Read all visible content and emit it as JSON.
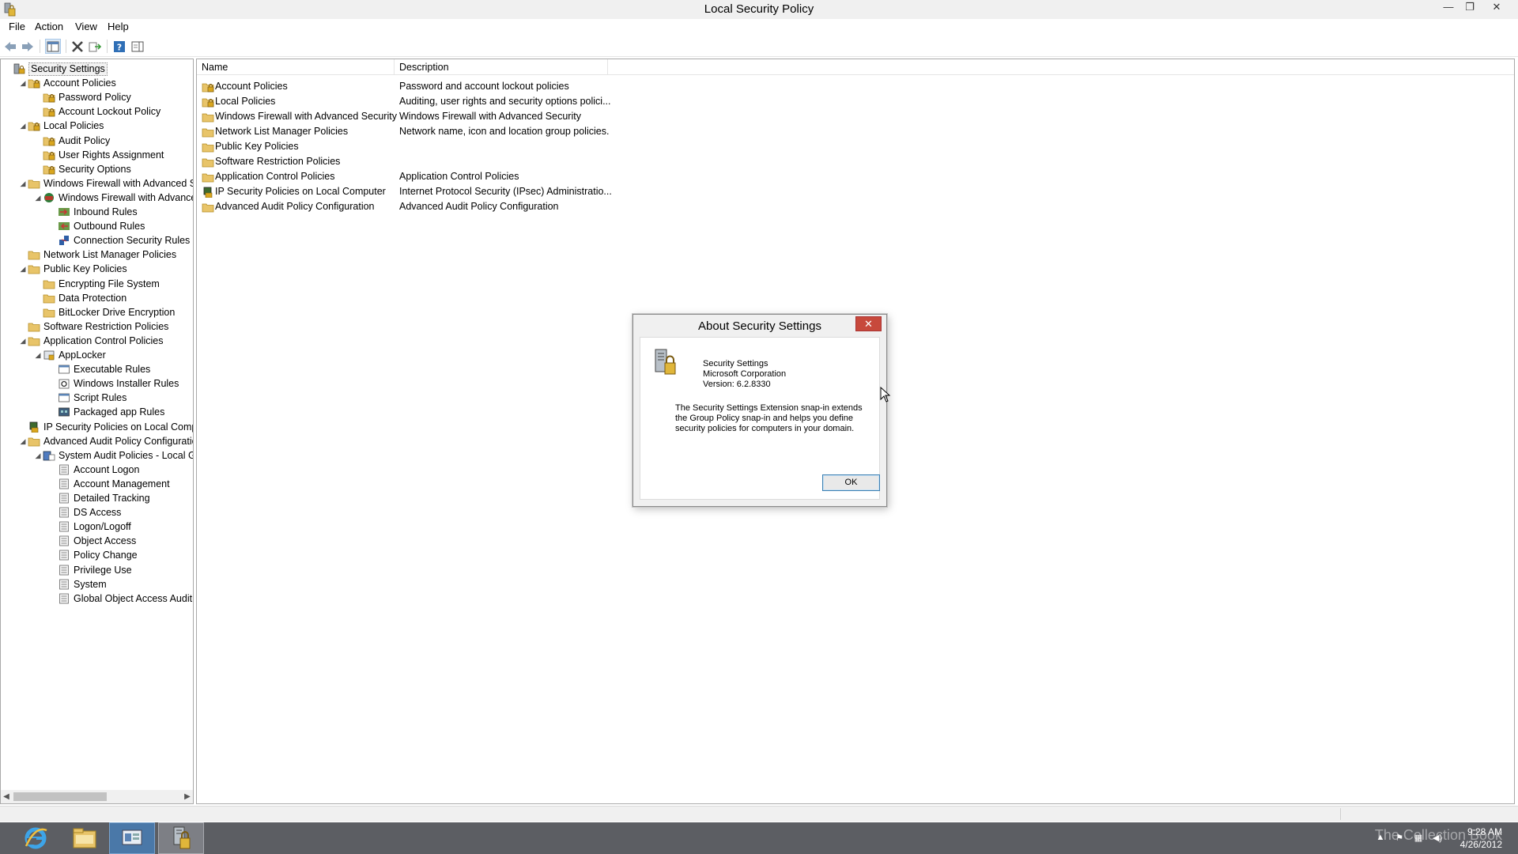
{
  "window": {
    "title": "Local Security Policy",
    "min_glyph": "—",
    "restore_glyph": "❐",
    "close_glyph": "✕"
  },
  "menu": [
    "File",
    "Action",
    "View",
    "Help"
  ],
  "tree": {
    "items": [
      {
        "label": "Security Settings",
        "indent": 0,
        "arrow": "",
        "icon": "security-settings-icon",
        "selected": true
      },
      {
        "label": "Account Policies",
        "indent": 1,
        "arrow": "◢",
        "icon": "policy-folder-icon"
      },
      {
        "label": "Password Policy",
        "indent": 2,
        "arrow": "",
        "icon": "policy-folder-icon"
      },
      {
        "label": "Account Lockout Policy",
        "indent": 2,
        "arrow": "",
        "icon": "policy-folder-icon"
      },
      {
        "label": "Local Policies",
        "indent": 1,
        "arrow": "◢",
        "icon": "policy-folder-icon"
      },
      {
        "label": "Audit Policy",
        "indent": 2,
        "arrow": "",
        "icon": "policy-folder-icon"
      },
      {
        "label": "User Rights Assignment",
        "indent": 2,
        "arrow": "",
        "icon": "policy-folder-icon"
      },
      {
        "label": "Security Options",
        "indent": 2,
        "arrow": "",
        "icon": "policy-folder-icon"
      },
      {
        "label": "Windows Firewall with Advanced Security",
        "indent": 1,
        "arrow": "◢",
        "icon": "folder-icon"
      },
      {
        "label": "Windows Firewall with Advanced Security - Local Group Policy Object",
        "indent": 2,
        "arrow": "◢",
        "icon": "firewall-icon"
      },
      {
        "label": "Inbound Rules",
        "indent": 3,
        "arrow": "",
        "icon": "inbound-rules-icon"
      },
      {
        "label": "Outbound Rules",
        "indent": 3,
        "arrow": "",
        "icon": "outbound-rules-icon"
      },
      {
        "label": "Connection Security Rules",
        "indent": 3,
        "arrow": "",
        "icon": "connection-rules-icon"
      },
      {
        "label": "Network List Manager Policies",
        "indent": 1,
        "arrow": "",
        "icon": "folder-icon"
      },
      {
        "label": "Public Key Policies",
        "indent": 1,
        "arrow": "◢",
        "icon": "folder-icon"
      },
      {
        "label": "Encrypting File System",
        "indent": 2,
        "arrow": "",
        "icon": "folder-icon"
      },
      {
        "label": "Data Protection",
        "indent": 2,
        "arrow": "",
        "icon": "folder-icon"
      },
      {
        "label": "BitLocker Drive Encryption",
        "indent": 2,
        "arrow": "",
        "icon": "folder-icon"
      },
      {
        "label": "Software Restriction Policies",
        "indent": 1,
        "arrow": "",
        "icon": "folder-icon"
      },
      {
        "label": "Application Control Policies",
        "indent": 1,
        "arrow": "◢",
        "icon": "folder-icon"
      },
      {
        "label": "AppLocker",
        "indent": 2,
        "arrow": "◢",
        "icon": "applocker-icon"
      },
      {
        "label": "Executable Rules",
        "indent": 3,
        "arrow": "",
        "icon": "rules-icon"
      },
      {
        "label": "Windows Installer Rules",
        "indent": 3,
        "arrow": "",
        "icon": "installer-rules-icon"
      },
      {
        "label": "Script Rules",
        "indent": 3,
        "arrow": "",
        "icon": "rules-icon"
      },
      {
        "label": "Packaged app Rules",
        "indent": 3,
        "arrow": "",
        "icon": "packaged-rules-icon"
      },
      {
        "label": "IP Security Policies on Local Computer",
        "indent": 1,
        "arrow": "",
        "icon": "ipsec-icon"
      },
      {
        "label": "Advanced Audit Policy Configuration",
        "indent": 1,
        "arrow": "◢",
        "icon": "folder-icon"
      },
      {
        "label": "System Audit Policies - Local Group Policy Object",
        "indent": 2,
        "arrow": "◢",
        "icon": "audit-policies-icon"
      },
      {
        "label": "Account Logon",
        "indent": 3,
        "arrow": "",
        "icon": "audit-category-icon"
      },
      {
        "label": "Account Management",
        "indent": 3,
        "arrow": "",
        "icon": "audit-category-icon"
      },
      {
        "label": "Detailed Tracking",
        "indent": 3,
        "arrow": "",
        "icon": "audit-category-icon"
      },
      {
        "label": "DS Access",
        "indent": 3,
        "arrow": "",
        "icon": "audit-category-icon"
      },
      {
        "label": "Logon/Logoff",
        "indent": 3,
        "arrow": "",
        "icon": "audit-category-icon"
      },
      {
        "label": "Object Access",
        "indent": 3,
        "arrow": "",
        "icon": "audit-category-icon"
      },
      {
        "label": "Policy Change",
        "indent": 3,
        "arrow": "",
        "icon": "audit-category-icon"
      },
      {
        "label": "Privilege Use",
        "indent": 3,
        "arrow": "",
        "icon": "audit-category-icon"
      },
      {
        "label": "System",
        "indent": 3,
        "arrow": "",
        "icon": "audit-category-icon"
      },
      {
        "label": "Global Object Access Auditing",
        "indent": 3,
        "arrow": "",
        "icon": "audit-category-icon"
      }
    ]
  },
  "list": {
    "columns": {
      "name": "Name",
      "description": "Description"
    },
    "rows": [
      {
        "name": "Account Policies",
        "description": "Password and account lockout policies",
        "icon": "policy-folder-icon"
      },
      {
        "name": "Local Policies",
        "description": "Auditing, user rights and security options polici...",
        "icon": "policy-folder-icon"
      },
      {
        "name": "Windows Firewall with Advanced Security",
        "description": "Windows Firewall with Advanced Security",
        "icon": "folder-icon"
      },
      {
        "name": "Network List Manager Policies",
        "description": "Network name, icon and location group policies.",
        "icon": "folder-icon"
      },
      {
        "name": "Public Key Policies",
        "description": "",
        "icon": "folder-icon"
      },
      {
        "name": "Software Restriction Policies",
        "description": "",
        "icon": "folder-icon"
      },
      {
        "name": "Application Control Policies",
        "description": "Application Control Policies",
        "icon": "folder-icon"
      },
      {
        "name": "IP Security Policies on Local Computer",
        "description": "Internet Protocol Security (IPsec) Administratio...",
        "icon": "ipsec-icon"
      },
      {
        "name": "Advanced Audit Policy Configuration",
        "description": "Advanced Audit Policy Configuration",
        "icon": "folder-icon"
      }
    ]
  },
  "dialog": {
    "title": "About Security Settings",
    "close_glyph": "✕",
    "product": "Security Settings",
    "company": "Microsoft Corporation",
    "version": "Version: 6.2.8330",
    "description": "The Security Settings Extension snap-in extends the Group Policy snap-in and helps you define security policies for computers in your domain.",
    "ok_label": "OK"
  },
  "taskbar": {
    "time": "9:28 AM",
    "date": "4/26/2012",
    "watermark": "The Collection Book"
  },
  "colors": {
    "folder": "#e8c469",
    "dialog_close": "#c7493c",
    "taskbar": "#5c5e63"
  }
}
